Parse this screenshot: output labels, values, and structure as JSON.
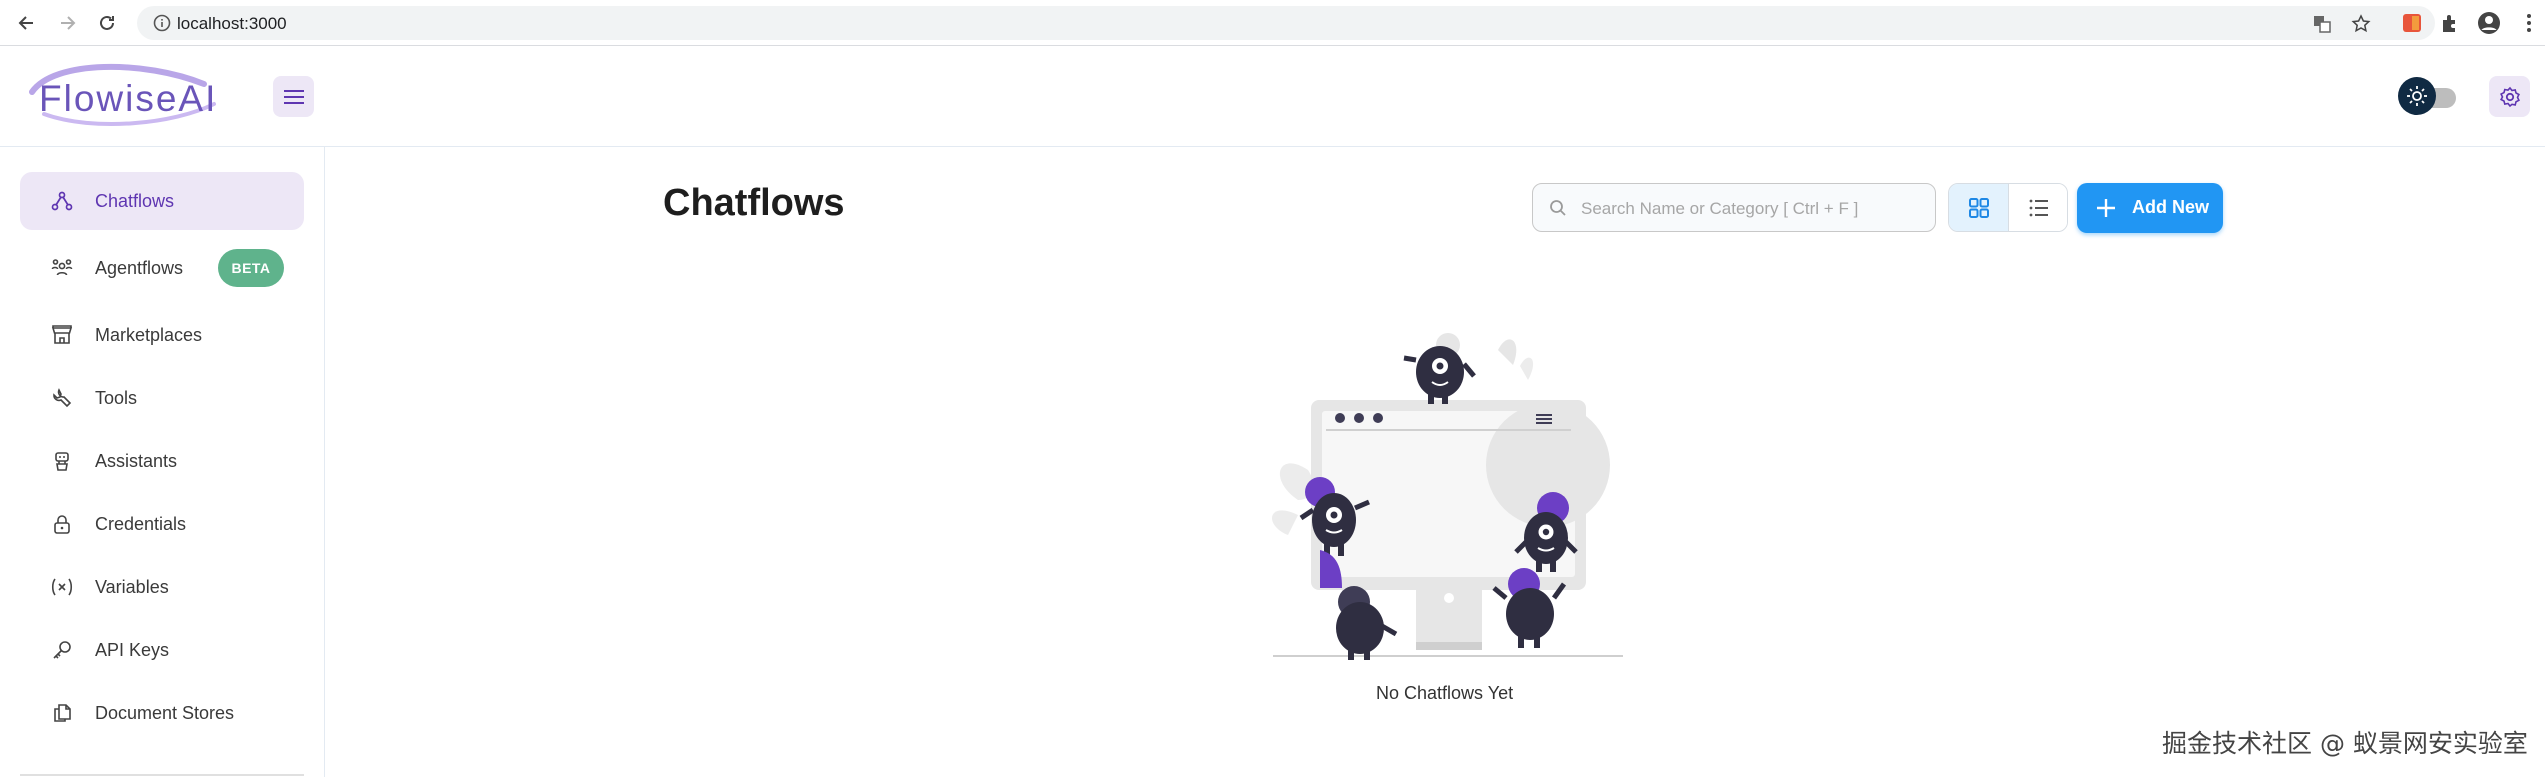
{
  "browser": {
    "url": "localhost:3000"
  },
  "header": {
    "logo_text": "FlowiseAI"
  },
  "sidebar": {
    "items": [
      {
        "label": "Chatflows",
        "icon": "hierarchy-icon",
        "active": true
      },
      {
        "label": "Agentflows",
        "icon": "users-group-icon",
        "badge": "BETA"
      },
      {
        "label": "Marketplaces",
        "icon": "building-store-icon"
      },
      {
        "label": "Tools",
        "icon": "tool-icon"
      },
      {
        "label": "Assistants",
        "icon": "robot-icon"
      },
      {
        "label": "Credentials",
        "icon": "lock-icon"
      },
      {
        "label": "Variables",
        "icon": "variable-icon"
      },
      {
        "label": "API Keys",
        "icon": "key-icon"
      },
      {
        "label": "Document Stores",
        "icon": "files-icon"
      }
    ]
  },
  "main": {
    "title": "Chatflows",
    "search_placeholder": "Search Name or Category [ Ctrl + F ]",
    "add_button_label": "Add New",
    "view_mode": "card",
    "empty_text": "No Chatflows Yet"
  },
  "watermark": "掘金技术社区 @ 蚁景网安实验室",
  "colors": {
    "primary_purple": "#5e35b1",
    "active_bg": "#ede7f6",
    "accent_blue": "#2196f3",
    "badge_green": "#5fb38c",
    "illustration_purple": "#6c3fc5",
    "illustration_dark": "#2f2e41"
  }
}
